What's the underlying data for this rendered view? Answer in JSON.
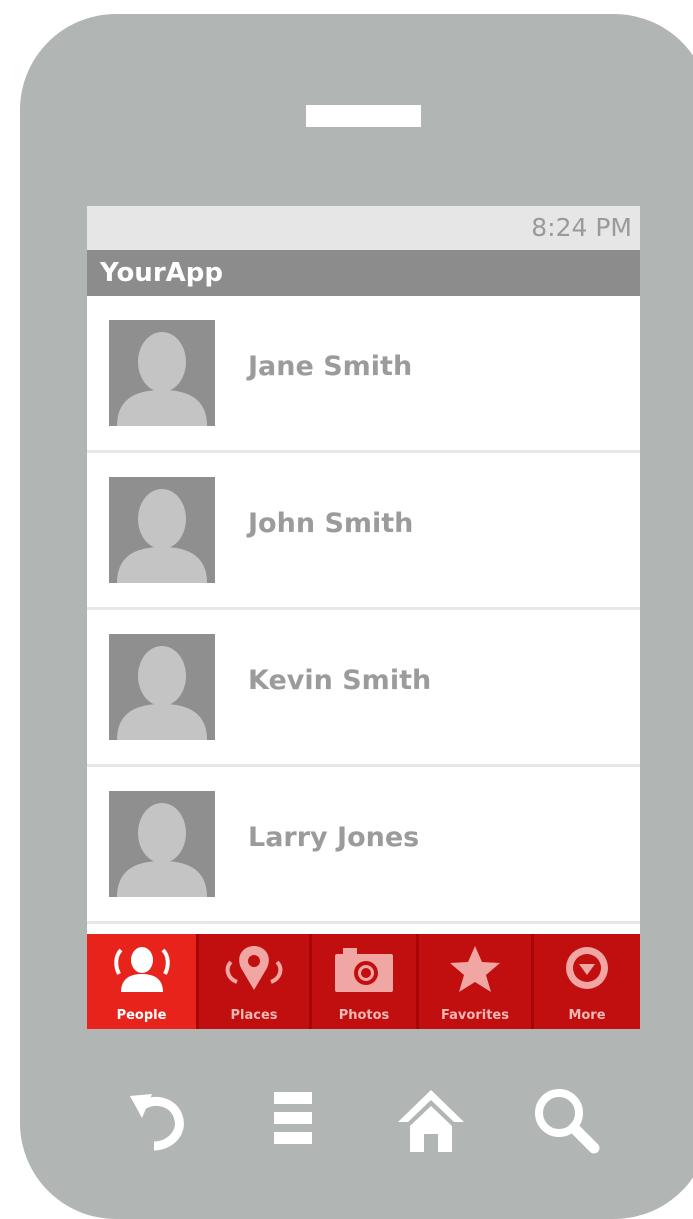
{
  "status_bar": {
    "time": "8:24 PM"
  },
  "app_bar": {
    "title": "YourApp"
  },
  "contacts": [
    {
      "name": "Jane Smith"
    },
    {
      "name": "John Smith"
    },
    {
      "name": "Kevin Smith"
    },
    {
      "name": "Larry Jones"
    }
  ],
  "tabs": [
    {
      "label": "People",
      "icon": "people-icon",
      "active": true
    },
    {
      "label": "Places",
      "icon": "map-pin-icon",
      "active": false
    },
    {
      "label": "Photos",
      "icon": "camera-icon",
      "active": false
    },
    {
      "label": "Favorites",
      "icon": "star-icon",
      "active": false
    },
    {
      "label": "More",
      "icon": "chevron-down-circle-icon",
      "active": false
    }
  ],
  "hardware_keys": [
    {
      "icon": "back-icon"
    },
    {
      "icon": "menu-icon"
    },
    {
      "icon": "home-icon"
    },
    {
      "icon": "search-icon"
    }
  ],
  "colors": {
    "phone_body": "#b1b5b4",
    "tab_bar": "#c10e0e",
    "tab_active": "#e8231b",
    "title_bar": "#8c8c8c"
  }
}
